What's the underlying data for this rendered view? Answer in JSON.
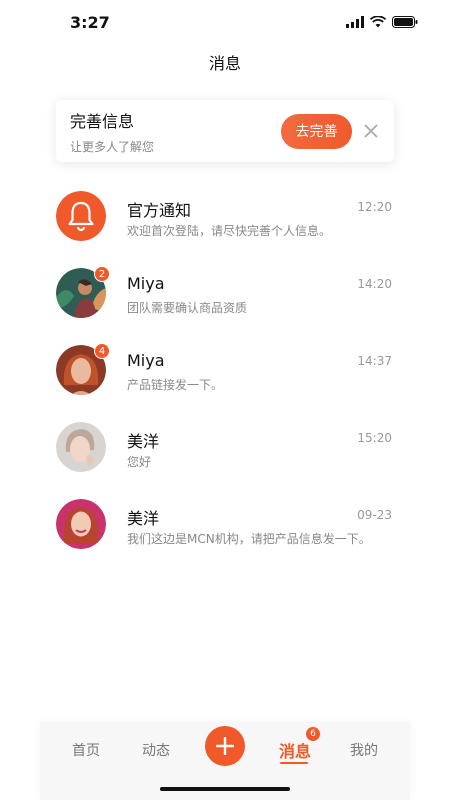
{
  "status": {
    "time": "3:27"
  },
  "page": {
    "title": "消息"
  },
  "profile_prompt": {
    "title": "完善信息",
    "subtitle": "让更多人了解您",
    "button_label": "去完善"
  },
  "messages": [
    {
      "name": "官方通知",
      "time": "12:20",
      "preview": "欢迎首次登陆，请尽快完善个人信息。",
      "avatar": "bell-icon",
      "badge": ""
    },
    {
      "name": "Miya",
      "time": "14:20",
      "preview": "团队需要确认商品资质",
      "avatar": "avatar-photo",
      "badge": "2"
    },
    {
      "name": "Miya",
      "time": "14:37",
      "preview": "产品链接发一下。",
      "avatar": "avatar-photo",
      "badge": "4"
    },
    {
      "name": "美洋",
      "time": "15:20",
      "preview": "您好",
      "avatar": "avatar-photo",
      "badge": ""
    },
    {
      "name": "美洋",
      "time": "09-23",
      "preview": "我们这边是MCN机构，请把产品信息发一下。",
      "avatar": "avatar-photo",
      "badge": ""
    }
  ],
  "tabs": {
    "home": "首页",
    "feed": "动态",
    "messages": "消息",
    "messages_badge": "6",
    "me": "我的"
  },
  "colors": {
    "accent": "#f05a2a",
    "text": "#111111",
    "muted": "#888888"
  }
}
